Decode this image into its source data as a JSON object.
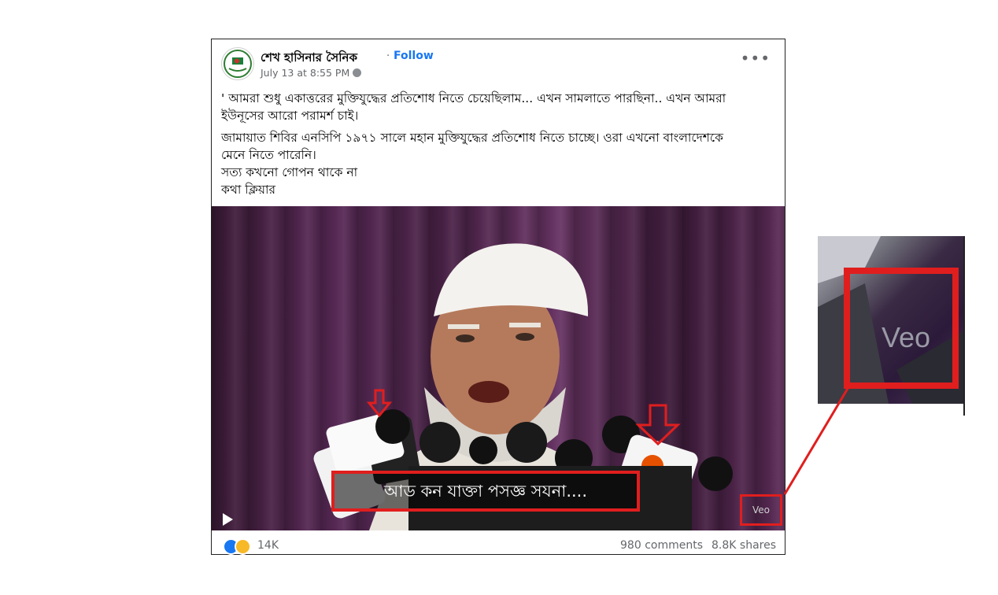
{
  "post": {
    "page_name": "শেখ হাসিনার সৈনিক",
    "separator": "·",
    "follow_label": "Follow",
    "timestamp": "July 13 at 8:55 PM",
    "privacy_icon": "settings-icon",
    "more_label": "•••",
    "text": {
      "paragraph1_line1": "' আমরা শুধু একাত্তরের মুক্তিযুদ্ধের প্রতিশোধ নিতে চেয়েছিলাম...  এখন সামলাতে পারছিনা.. এখন আমরা",
      "paragraph1_line2": "ইউনূসের  আরো  পরামর্শ চাই।",
      "paragraph2_line1": "জামায়াত শিবির এনসিপি ১৯৭১ সালে মহান মুক্তিযুদ্ধের প্রতিশোধ নিতে চাচ্ছে। ওরা এখনো বাংলাদেশকে",
      "paragraph2_line2": "মেনে নিতে পারেনি।",
      "line3": "সত্য কখনো গোপন থাকে না",
      "line4": "কথা ক্লিয়ার"
    },
    "video": {
      "caption": "আড কন যাক্তা পসজ্ঞ সযনা....",
      "watermark": "Veo"
    },
    "reactions": {
      "icons": [
        "like-icon",
        "haha-icon"
      ],
      "count": "14K"
    },
    "comments": "980 comments",
    "shares": "8.8K shares"
  },
  "zoom_inset": {
    "watermark": "Veo"
  },
  "colors": {
    "highlight": "#e01e1e",
    "link": "#1877f2",
    "secondary_text": "#65676b"
  }
}
